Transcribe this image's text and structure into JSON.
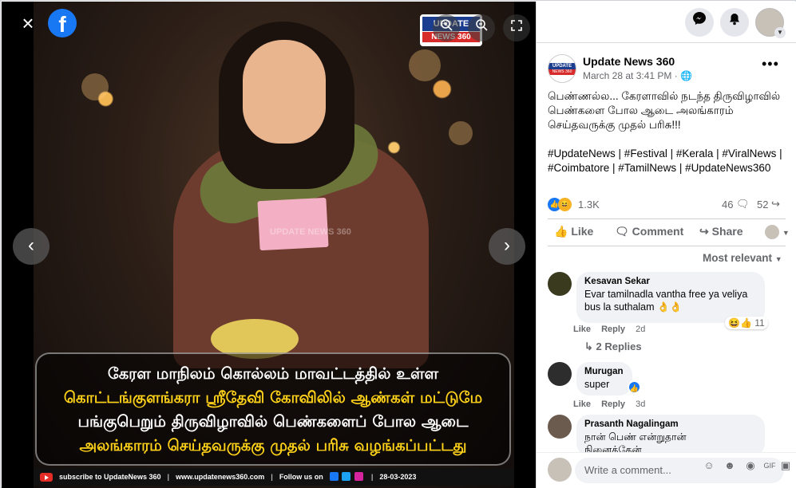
{
  "viewer": {
    "close_icon": "×",
    "fb_logo": "f",
    "brand_logo_line1": "UPDATE",
    "brand_logo_line2": "NEWS 360",
    "watermark": "UPDATE NEWS 360",
    "caption_lines": [
      "கேரள மாநிலம் கொல்லம் மாவட்டத்தில் உள்ள",
      "கொட்டங்குளங்கரா ஸ்ரீதேவி கோவிலில் ஆண்கள் மட்டுமே",
      "பங்குபெறும் திருவிழாவில் பெண்களைப் போல ஆடை",
      "அலங்காரம் செய்தவருக்கு முதல் பரிசு வழங்கப்பட்டது"
    ],
    "footer": {
      "subscribe": "subscribe to UpdateNews 360",
      "website": "www.updatenews360.com",
      "follow": "Follow us on",
      "date": "28-03-2023"
    },
    "prev_icon": "‹",
    "next_icon": "›",
    "icons": [
      "zoom-in-icon",
      "zoom-out-icon",
      "fullscreen-icon"
    ],
    "colors": {
      "caption_yellow": "#ffd21a",
      "fb_blue": "#1877f2"
    }
  },
  "post": {
    "page_name": "Update News 360",
    "time": "March 28 at 3:41 PM · ",
    "text": "பெண்ணல்ல... கேரளாவில் நடந்த திருவிழாவில் பெண்களை போல ஆடை அலங்காரம் செய்தவருக்கு முதல் பரிசு!!!",
    "hashtags": "#UpdateNews | #Festival | #Kerala | #ViralNews | #Coimbatore | #TamilNews | #UpdateNews360",
    "reaction_count": "1.3K",
    "comment_count": "46",
    "share_count": "52",
    "actions": {
      "like": "Like",
      "comment": "Comment",
      "share": "Share"
    },
    "sort_label": "Most relevant"
  },
  "comments": [
    {
      "name": "Kesavan Sekar",
      "text": "Evar tamilnadla vantha free ya veliya bus la suthalam 👌👌",
      "like": "Like",
      "reply": "Reply",
      "age": "2d",
      "reactions": "11"
    },
    {
      "name": "Murugan",
      "text": "super",
      "like": "Like",
      "reply": "Reply",
      "age": "3d"
    },
    {
      "name": "Prasanth Nagalingam",
      "text": "நான் பெண் என்றுதான் நினைத்தேன்"
    }
  ],
  "replies_label": "2 Replies",
  "write_placeholder": "Write a comment..."
}
